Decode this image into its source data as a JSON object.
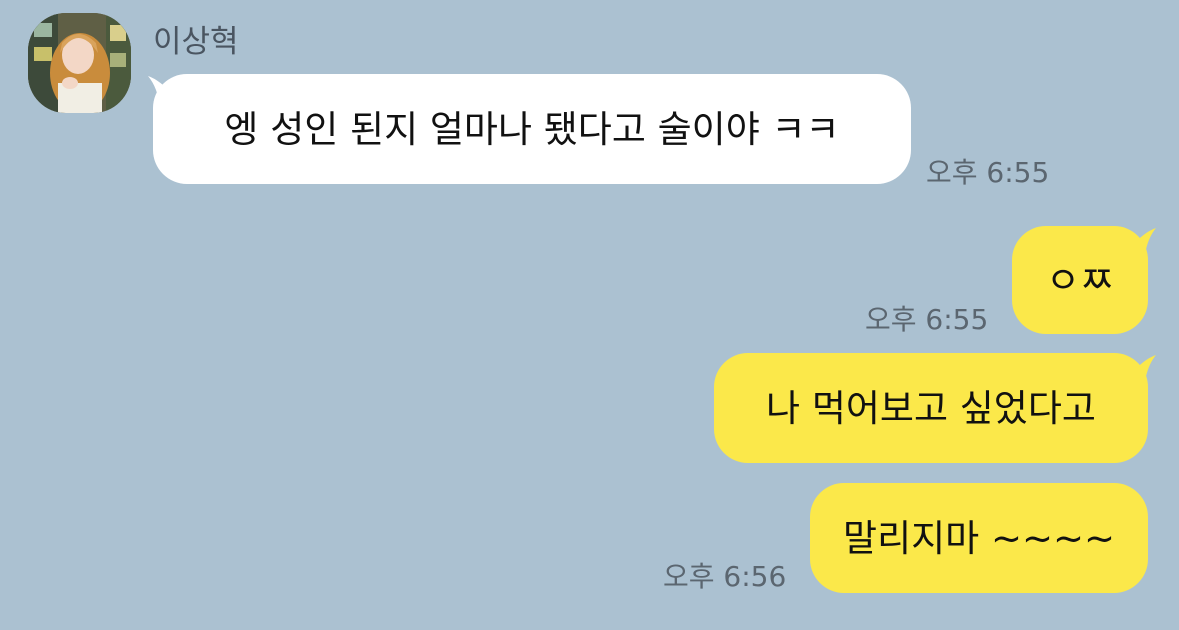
{
  "chat": {
    "sender_name": "이상혁",
    "messages": [
      {
        "direction": "incoming",
        "text": "엥 성인 된지 얼마나 됐다고 술이야 ㅋㅋ",
        "time": "오후 6:55"
      },
      {
        "direction": "outgoing",
        "text": "ㅇㅉ",
        "time": "오후 6:55"
      },
      {
        "direction": "outgoing",
        "text": "나 먹어보고 싶었다고",
        "time": ""
      },
      {
        "direction": "outgoing",
        "text": "말리지마 ~~~~",
        "time": "오후 6:56"
      }
    ]
  },
  "colors": {
    "background": "#abc1d1",
    "incoming_bubble": "#ffffff",
    "outgoing_bubble": "#fbe84a",
    "timestamp": "#5b6670",
    "name": "#4a5561"
  }
}
